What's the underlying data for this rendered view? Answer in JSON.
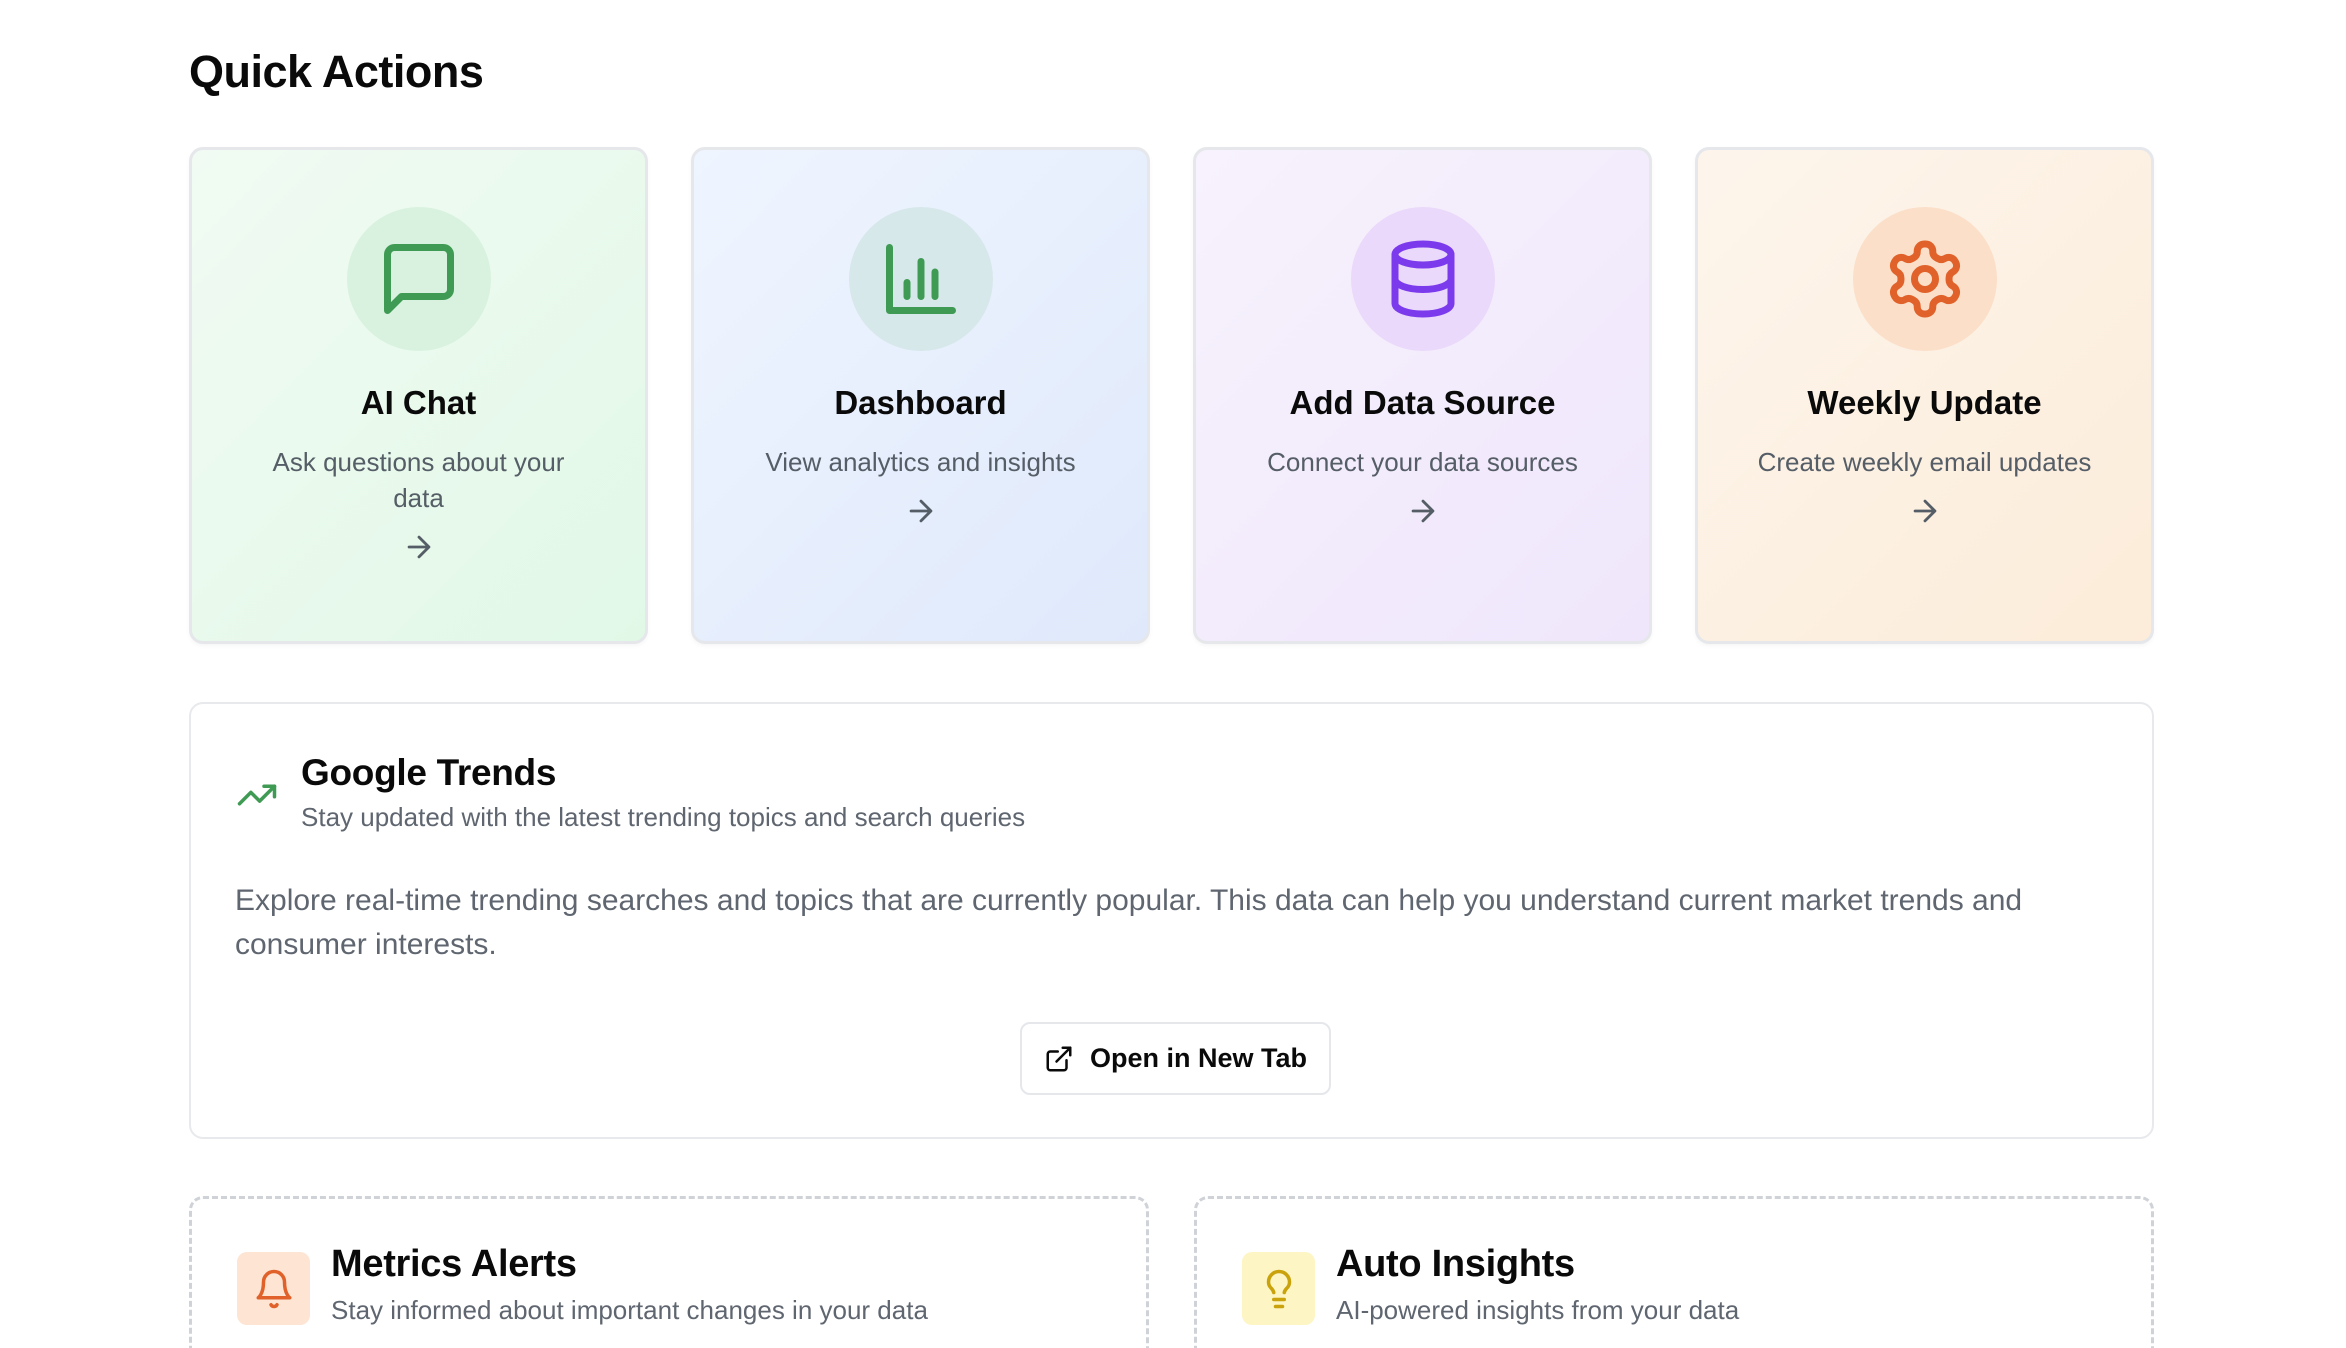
{
  "quick_actions": {
    "title": "Quick Actions",
    "cards": [
      {
        "title": "AI Chat",
        "description": "Ask questions about your data",
        "icon": "message-square-icon",
        "accent": "#3f9b54"
      },
      {
        "title": "Dashboard",
        "description": "View analytics and insights",
        "icon": "bar-chart-icon",
        "accent": "#3f9b54"
      },
      {
        "title": "Add Data Source",
        "description": "Connect your data sources",
        "icon": "database-icon",
        "accent": "#7c3aed"
      },
      {
        "title": "Weekly Update",
        "description": "Create weekly email updates",
        "icon": "settings-icon",
        "accent": "#e0622a"
      }
    ]
  },
  "google_trends": {
    "title": "Google Trends",
    "subtitle": "Stay updated with the latest trending topics and search queries",
    "body": "Explore real-time trending searches and topics that are currently popular. This data can help you understand current market trends and consumer interests.",
    "button_label": "Open in New Tab",
    "icon": "trending-up-icon",
    "accent": "#3f9b54"
  },
  "features": [
    {
      "title": "Metrics Alerts",
      "subtitle": "Stay informed about important changes in your data",
      "icon": "bell-icon",
      "accent": "#e0622a"
    },
    {
      "title": "Auto Insights",
      "subtitle": "AI-powered insights from your data",
      "icon": "lightbulb-icon",
      "accent": "#c9a20c"
    }
  ]
}
